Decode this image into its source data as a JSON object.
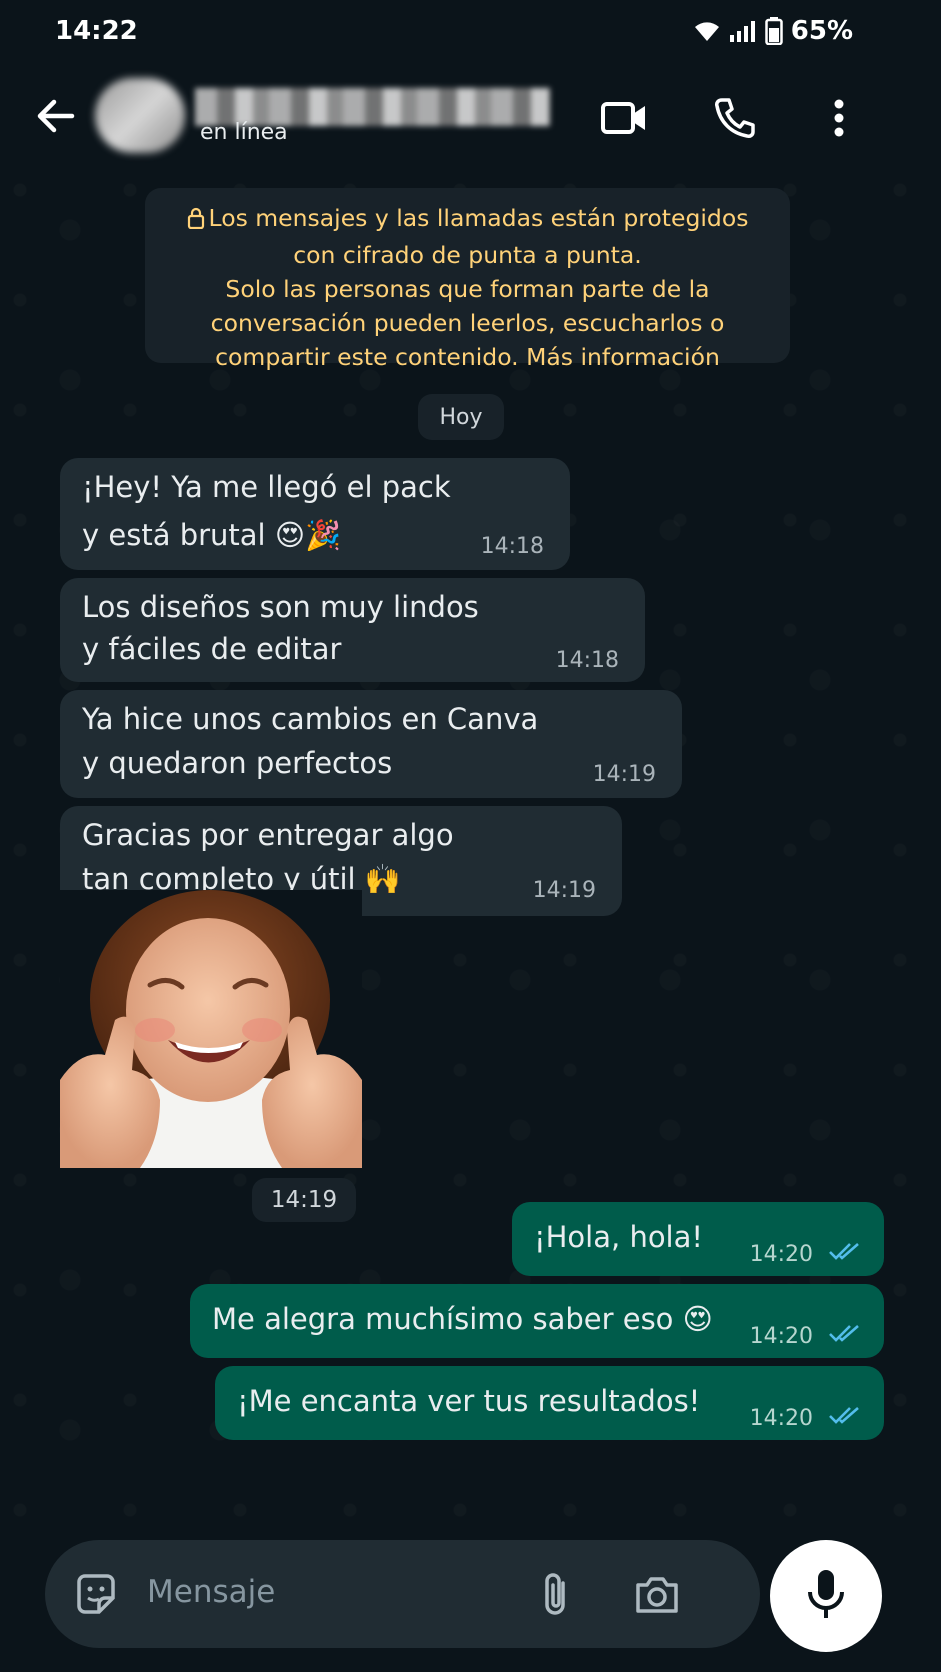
{
  "statusbar": {
    "time": "14:22",
    "battery": "65%"
  },
  "header": {
    "status": "en línea",
    "icons": [
      "back-arrow-icon",
      "video-call-icon",
      "phone-icon",
      "more-vert-icon"
    ]
  },
  "notice": {
    "line1": "Los mensajes y las llamadas están protegidos",
    "line2": "con cifrado de punta a punta.",
    "line3": "Solo las personas que forman parte de la",
    "line4": "conversación pueden leerlos, escucharlos o",
    "line5": "compartir este contenido. Más información"
  },
  "date_chip": "Hoy",
  "messages": [
    {
      "dir": "in",
      "line1": "¡Hey! Ya me llegó el pack",
      "line2": "y está brutal 😍🎉",
      "time": "14:18"
    },
    {
      "dir": "in",
      "line1": "Los diseños son muy lindos",
      "line2": "y fáciles de editar",
      "time": "14:18"
    },
    {
      "dir": "in",
      "line1": "Ya hice unos cambios en Canva",
      "line2": "y quedaron perfectos",
      "time": "14:19"
    },
    {
      "dir": "in",
      "line1": "Gracias por entregar algo",
      "line2": "tan completo y útil 🙌",
      "time": "14:19"
    },
    {
      "dir": "in",
      "type": "sticker",
      "time": "14:19"
    },
    {
      "dir": "out",
      "line1": "¡Hola, hola!",
      "time": "14:20",
      "read": true
    },
    {
      "dir": "out",
      "line1": "Me alegra muchísimo saber eso 😍",
      "time": "14:20",
      "read": true
    },
    {
      "dir": "out",
      "line1": "¡Me encanta ver tus resultados!",
      "time": "14:20",
      "read": true
    }
  ],
  "composer": {
    "placeholder": "Mensaje"
  },
  "colors": {
    "incoming": "#202c33",
    "outgoing": "#005c4b",
    "notice_text": "#ffd279",
    "read_ticks": "#53bdeb"
  }
}
